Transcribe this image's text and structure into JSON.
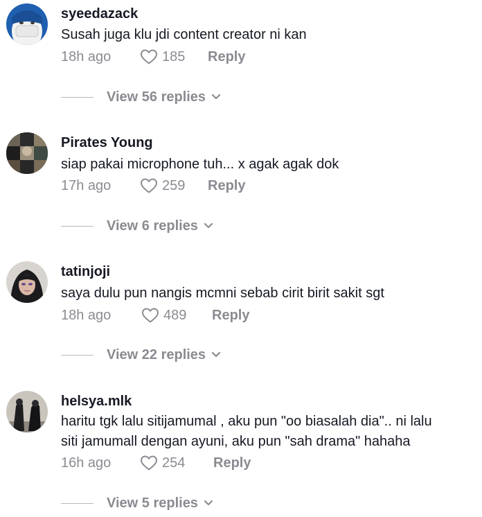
{
  "comments": [
    {
      "username": "syeedazack",
      "text": "Susah juga klu jdi content creator ni kan",
      "time": "18h ago",
      "likes": "185",
      "reply_label": "Reply",
      "view_replies": "View 56 replies"
    },
    {
      "username": "Pirates Young",
      "text": "siap pakai microphone tuh... x agak agak dok",
      "time": "17h ago",
      "likes": "259",
      "reply_label": "Reply",
      "view_replies": "View 6 replies"
    },
    {
      "username": "tatinjoji",
      "text": "saya dulu pun nangis mcmni sebab cirit birit sakit sgt",
      "time": "18h ago",
      "likes": "489",
      "reply_label": "Reply",
      "view_replies": "View 22 replies"
    },
    {
      "username": "helsya.mlk",
      "text_line1": "haritu tgk lalu sitijamumal , aku pun \"oo biasalah dia\".. ni lalu",
      "text_line2": "siti jamumall dengan ayuni, aku pun \"sah drama\" hahaha",
      "time": "16h ago",
      "likes": "254",
      "reply_label": "Reply",
      "view_replies": "View 5 replies"
    }
  ],
  "icons": {
    "like": "heart-outline-icon",
    "expand": "chevron-down-icon"
  },
  "colors": {
    "primary_text": "#161823",
    "secondary_text": "#8a8b91",
    "divider": "#b8b9bd"
  }
}
